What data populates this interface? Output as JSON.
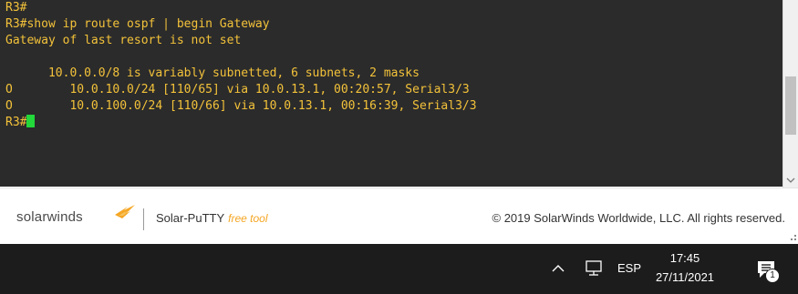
{
  "terminal": {
    "lines": [
      "R3#",
      "R3#show ip route ospf | begin Gateway",
      "Gateway of last resort is not set",
      "",
      "      10.0.0.0/8 is variably subnetted, 6 subnets, 2 masks",
      "O        10.0.10.0/24 [110/65] via 10.0.13.1, 00:20:57, Serial3/3",
      "O        10.0.100.0/24 [110/66] via 10.0.13.1, 00:16:39, Serial3/3"
    ],
    "prompt": "R3#",
    "text_color": "#f3c23a",
    "background_color": "#2b2b2b",
    "cursor_color": "#22d83a"
  },
  "footer": {
    "brand": "solarwinds",
    "product": "Solar-PuTTY",
    "free_tool": "free tool",
    "copyright": "© 2019 SolarWinds Worldwide, LLC. All rights reserved.",
    "brand_icon": "solarwinds-flame-icon",
    "accent_color": "#f5a623"
  },
  "taskbar": {
    "language": "ESP",
    "time": "17:45",
    "date": "27/11/2021",
    "notification_count": "1",
    "icons": [
      "chevron-up-icon",
      "network-icon",
      "notification-icon"
    ]
  }
}
